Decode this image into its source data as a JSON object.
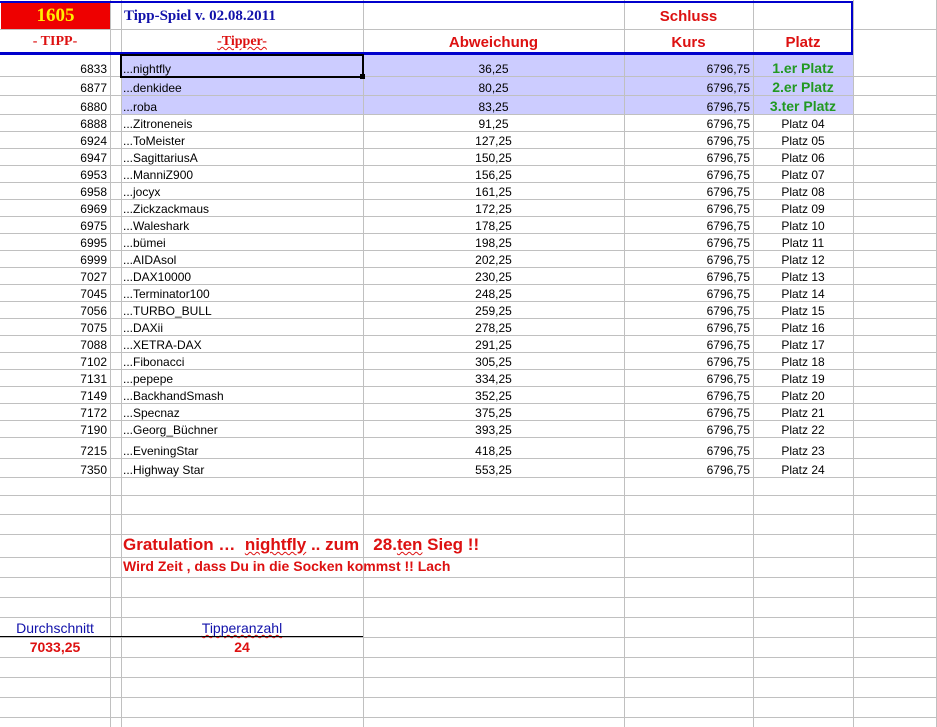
{
  "header": {
    "id_number": "1605",
    "title": "Tipp-Spiel v. 02.08.2011",
    "schluss": "Schluss",
    "col_tipp": "- TIPP-",
    "col_tipper": "-Tipper-",
    "col_abweichung": "Abweichung",
    "col_kurs": "Kurs",
    "col_platz": "Platz"
  },
  "rows": [
    {
      "tipp": "6833",
      "tipper": "...nightfly",
      "abw": "36,25",
      "kurs": "6796,75",
      "platz": "1.er Platz"
    },
    {
      "tipp": "6877",
      "tipper": "...denkidee",
      "abw": "80,25",
      "kurs": "6796,75",
      "platz": "2.er Platz"
    },
    {
      "tipp": "6880",
      "tipper": "...roba",
      "abw": "83,25",
      "kurs": "6796,75",
      "platz": "3.ter Platz"
    },
    {
      "tipp": "6888",
      "tipper": "...Zitroneneis",
      "abw": "91,25",
      "kurs": "6796,75",
      "platz": "Platz 04"
    },
    {
      "tipp": "6924",
      "tipper": "...ToMeister",
      "abw": "127,25",
      "kurs": "6796,75",
      "platz": "Platz 05"
    },
    {
      "tipp": "6947",
      "tipper": "...SagittariusA",
      "abw": "150,25",
      "kurs": "6796,75",
      "platz": "Platz 06"
    },
    {
      "tipp": "6953",
      "tipper": "...ManniZ900",
      "abw": "156,25",
      "kurs": "6796,75",
      "platz": "Platz 07"
    },
    {
      "tipp": "6958",
      "tipper": "...jocyx",
      "abw": "161,25",
      "kurs": "6796,75",
      "platz": "Platz 08"
    },
    {
      "tipp": "6969",
      "tipper": "...Zickzackmaus",
      "abw": "172,25",
      "kurs": "6796,75",
      "platz": "Platz 09"
    },
    {
      "tipp": "6975",
      "tipper": "...Waleshark",
      "abw": "178,25",
      "kurs": "6796,75",
      "platz": "Platz 10"
    },
    {
      "tipp": "6995",
      "tipper": "...bümei",
      "abw": "198,25",
      "kurs": "6796,75",
      "platz": "Platz 11"
    },
    {
      "tipp": "6999",
      "tipper": "...AIDAsol",
      "abw": "202,25",
      "kurs": "6796,75",
      "platz": "Platz 12"
    },
    {
      "tipp": "7027",
      "tipper": "...DAX10000",
      "abw": "230,25",
      "kurs": "6796,75",
      "platz": "Platz 13"
    },
    {
      "tipp": "7045",
      "tipper": "...Terminator100",
      "abw": "248,25",
      "kurs": "6796,75",
      "platz": "Platz 14"
    },
    {
      "tipp": "7056",
      "tipper": "...TURBO_BULL",
      "abw": "259,25",
      "kurs": "6796,75",
      "platz": "Platz 15"
    },
    {
      "tipp": "7075",
      "tipper": "...DAXii",
      "abw": "278,25",
      "kurs": "6796,75",
      "platz": "Platz 16"
    },
    {
      "tipp": "7088",
      "tipper": "...XETRA-DAX",
      "abw": "291,25",
      "kurs": "6796,75",
      "platz": "Platz 17"
    },
    {
      "tipp": "7102",
      "tipper": "...Fibonacci",
      "abw": "305,25",
      "kurs": "6796,75",
      "platz": "Platz 18"
    },
    {
      "tipp": "7131",
      "tipper": "...pepepe",
      "abw": "334,25",
      "kurs": "6796,75",
      "platz": "Platz 19"
    },
    {
      "tipp": "7149",
      "tipper": "...BackhandSmash",
      "abw": "352,25",
      "kurs": "6796,75",
      "platz": "Platz 20"
    },
    {
      "tipp": "7172",
      "tipper": "...Specnaz",
      "abw": "375,25",
      "kurs": "6796,75",
      "platz": "Platz 21"
    },
    {
      "tipp": "7190",
      "tipper": "...Georg_Büchner",
      "abw": "393,25",
      "kurs": "6796,75",
      "platz": "Platz 22"
    },
    {
      "tipp": "7215",
      "tipper": "...EveningStar",
      "abw": "418,25",
      "kurs": "6796,75",
      "platz": "Platz 23"
    },
    {
      "tipp": "7350",
      "tipper": "...Highway Star",
      "abw": "553,25",
      "kurs": "6796,75",
      "platz": "Platz 24"
    }
  ],
  "message": {
    "line1_a": "Gratulation …  ",
    "line1_name": "nightfly",
    "line1_b": " .. zum   28.",
    "line1_ten": "ten",
    "line1_c": " Sieg !!",
    "line2": "Wird Zeit , dass Du in die Socken kommst !! Lach"
  },
  "summary": {
    "avg_label": "Durchschnitt",
    "avg_value": "7033,25",
    "count_label": "Tipperanzahl",
    "count_value": "24"
  },
  "colors": {
    "accent_blue": "#0000cc",
    "header_red": "#dd1111",
    "highlight": "#ccccff",
    "podium_green": "#229922"
  }
}
